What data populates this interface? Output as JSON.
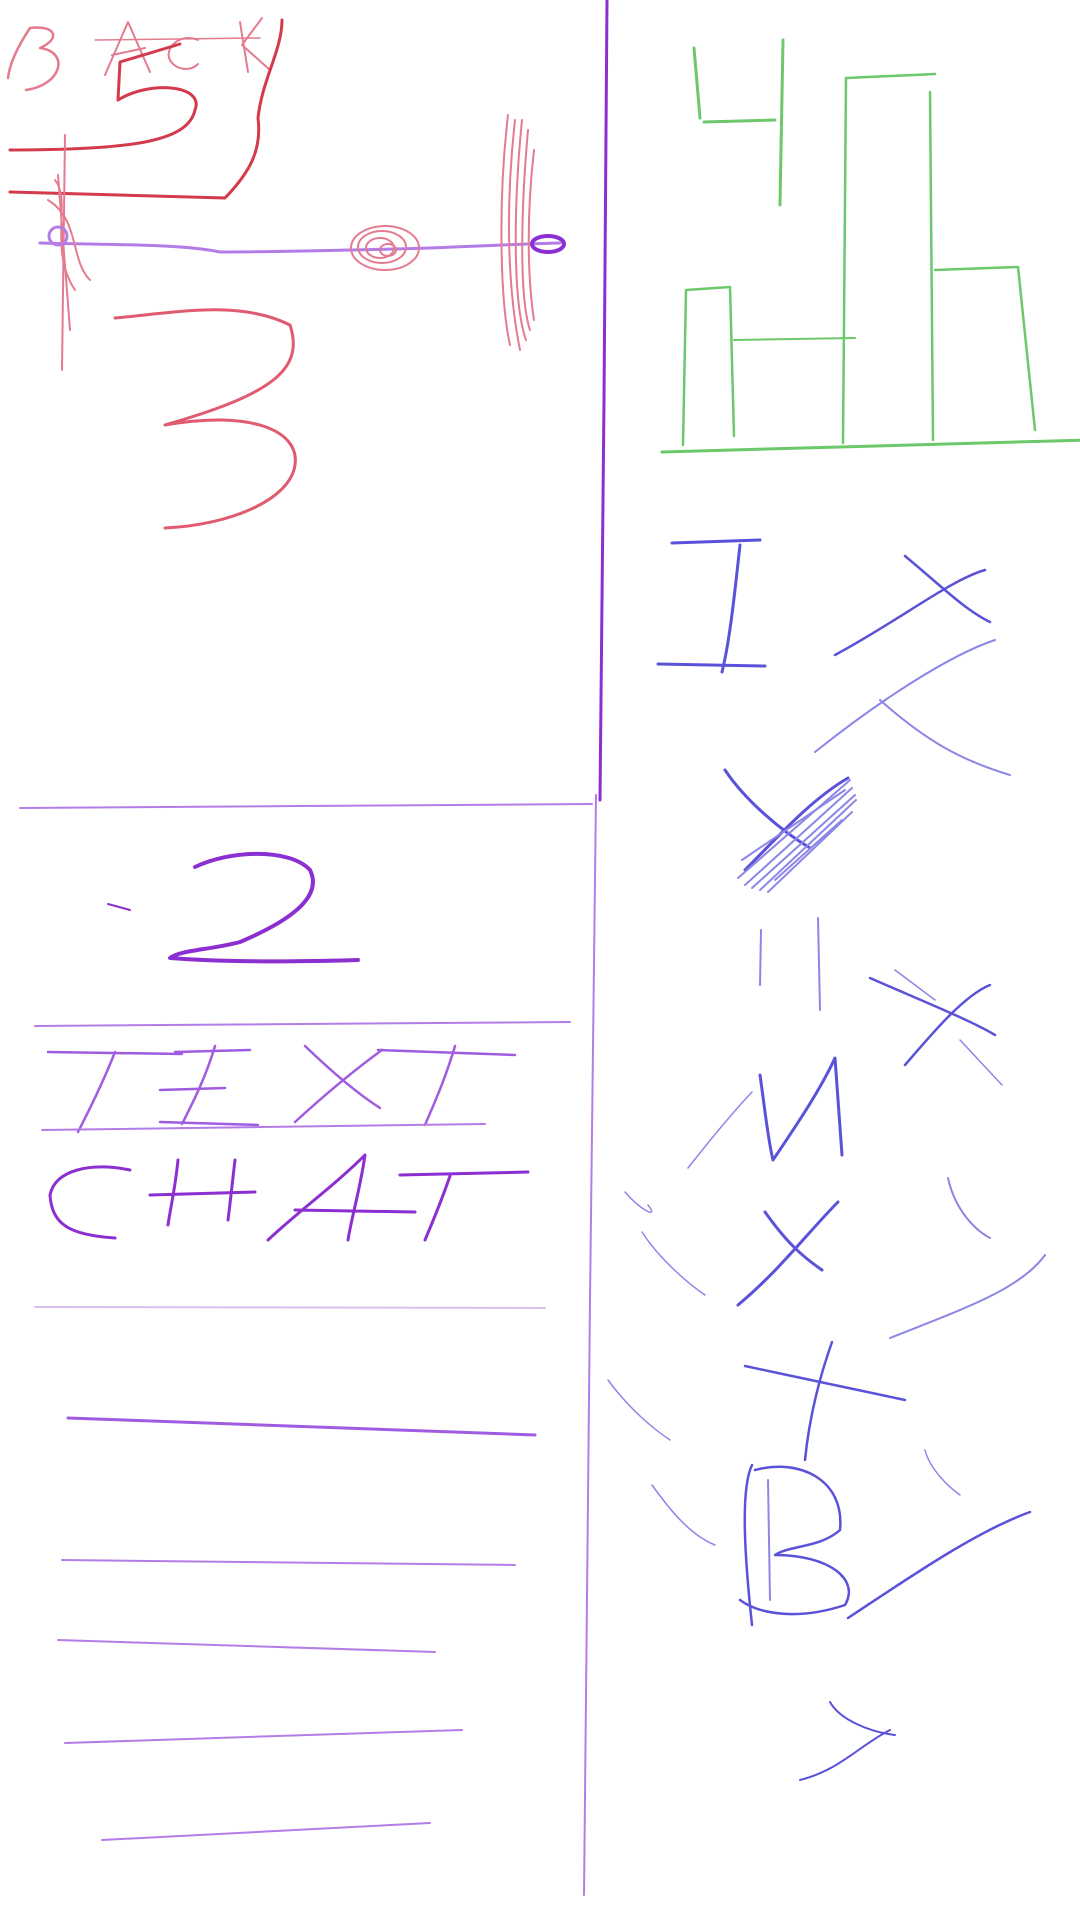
{
  "canvas": {
    "background": "#ffffff"
  },
  "colors": {
    "red_strong": "#d33a4c",
    "red_soft": "#e47b8f",
    "purple": "#8c2fd1",
    "purple_soft": "#b47ce6",
    "green": "#6cc86a",
    "blue": "#5a52d8",
    "blue_soft": "#8c86e6"
  },
  "sketch": {
    "top_left": {
      "scrawl_text": "BACK",
      "digit_5": "5",
      "digit_3": "3"
    },
    "top_right": {
      "bar_chart_sketch_digit": "4"
    },
    "right_column_letters": {
      "i": "I",
      "x1": "X",
      "y": "Y",
      "m": "M",
      "x2": "X",
      "t": "T",
      "b": "B"
    },
    "bottom_left": {
      "digit_2": "2",
      "word_text": "TEXT",
      "word_chat": "CHAT"
    }
  }
}
